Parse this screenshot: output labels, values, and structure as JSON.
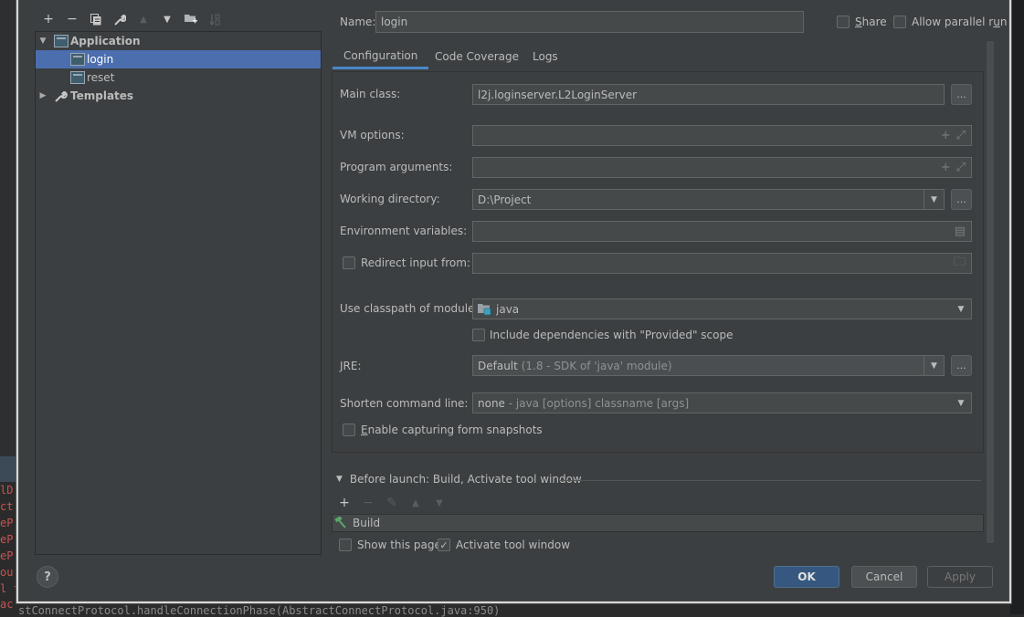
{
  "background": {
    "code_fragments": [
      "lD",
      "ct",
      "eP",
      "eP",
      "eP",
      "ou",
      "l f",
      "ac"
    ],
    "bottom_line": "stConnectProtocol.handleConnectionPhase(AbstractConnectProtocol.java:950)"
  },
  "sidebar": {
    "toolbar": {
      "add": "+",
      "remove": "−",
      "copy": "⧉",
      "edit_defaults": "🔧",
      "move_up": "▲",
      "move_down": "▼",
      "new_folder": "📁",
      "sort": "⇅"
    },
    "tree": [
      {
        "label": "Application",
        "level": 0,
        "expanded": true,
        "icon": "application-icon"
      },
      {
        "label": "login",
        "level": 1,
        "selected": true,
        "icon": "run-config-icon"
      },
      {
        "label": "reset",
        "level": 1,
        "icon": "run-config-icon"
      },
      {
        "label": "Templates",
        "level": 0,
        "expanded": false,
        "icon": "wrench-icon"
      }
    ],
    "help_label": "?"
  },
  "header": {
    "name_label": "Name:",
    "name_value": "login",
    "share_label_u": "S",
    "share_label_rest": "hare",
    "share_checked": false,
    "parallel_label_pre": "Allow parallel r",
    "parallel_label_u": "u",
    "parallel_label_post": "n",
    "parallel_checked": false
  },
  "tabs": [
    {
      "label": "Configuration",
      "active": true
    },
    {
      "label": "Code Coverage",
      "active": false
    },
    {
      "label": "Logs",
      "active": false
    }
  ],
  "config": {
    "main_class": {
      "label": "Main class:",
      "value": "l2j.loginserver.L2LoginServer",
      "button": "..."
    },
    "vm_options": {
      "label": "VM options:",
      "value": ""
    },
    "program_args": {
      "label": "Program arguments:",
      "value": ""
    },
    "working_dir": {
      "label": "Working directory:",
      "value": "D:\\Project",
      "button": "..."
    },
    "env_vars": {
      "label": "Environment variables:",
      "value": ""
    },
    "redirect_input": {
      "label": "Redirect input from:",
      "checked": false,
      "value": ""
    },
    "classpath_module": {
      "label": "Use classpath of module:",
      "value": "java"
    },
    "include_provided": {
      "label": "Include dependencies with \"Provided\" scope",
      "checked": false
    },
    "jre": {
      "label": "JRE:",
      "value_main": "Default",
      "value_detail": "(1.8 - SDK of 'java' module)",
      "button": "..."
    },
    "shorten_cmd": {
      "label": "Shorten command line:",
      "value_main": "none",
      "value_detail": " - java [options] classname [args]"
    },
    "form_snapshots": {
      "label_u": "E",
      "label_rest": "nable capturing form snapshots",
      "checked": false
    }
  },
  "before_launch": {
    "header": "Before launch: Build, Activate tool window",
    "toolbar": {
      "add": "+",
      "remove": "−",
      "edit": "✎",
      "up": "▲",
      "down": "▼"
    },
    "tasks": [
      "Build"
    ],
    "show_page": {
      "label": "Show this page",
      "checked": false
    },
    "activate_tool": {
      "label": "Activate tool window",
      "checked": true
    }
  },
  "buttons": {
    "ok": "OK",
    "cancel": "Cancel",
    "apply": "Apply"
  },
  "colors": {
    "selection": "#4b6eaf",
    "accent_tab": "#4a88c7",
    "ok_button": "#365880"
  }
}
